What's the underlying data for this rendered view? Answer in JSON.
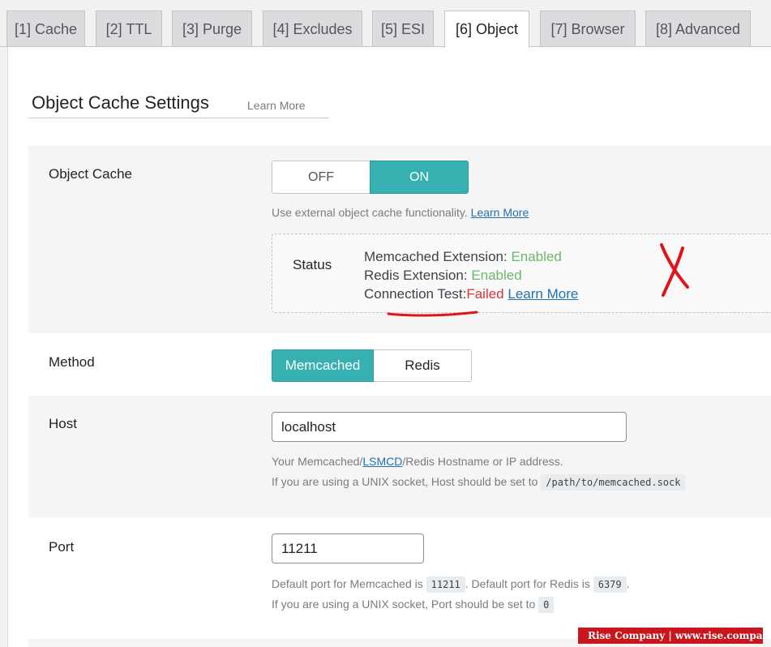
{
  "tabs": [
    {
      "label": "[1] Cache"
    },
    {
      "label": "[2] TTL"
    },
    {
      "label": "[3] Purge"
    },
    {
      "label": "[4] Excludes"
    },
    {
      "label": "[5] ESI"
    },
    {
      "label": "[6] Object"
    },
    {
      "label": "[7] Browser"
    },
    {
      "label": "[8] Advanced"
    }
  ],
  "active_tab": "[6] Object",
  "section": {
    "title": "Object Cache Settings",
    "learn_more": "Learn More"
  },
  "object_cache": {
    "label": "Object Cache",
    "off_label": "OFF",
    "on_label": "ON",
    "selected": "ON",
    "description": "Use external object cache functionality.",
    "description_link": "Learn More"
  },
  "status": {
    "label": "Status",
    "memcached_label": "Memcached Extension:",
    "memcached_value": "Enabled",
    "redis_label": "Redis Extension:",
    "redis_value": "Enabled",
    "connection_label": "Connection Test:",
    "connection_value": "Failed",
    "connection_link": "Learn More"
  },
  "method": {
    "label": "Method",
    "options": [
      "Memcached",
      "Redis"
    ],
    "selected": "Memcached"
  },
  "host": {
    "label": "Host",
    "value": "localhost",
    "desc_prefix": "Your Memcached/",
    "desc_link": "LSMCD",
    "desc_suffix": "/Redis Hostname or IP address.",
    "desc2": "If you are using a UNIX socket, Host should be set to",
    "desc2_code": "/path/to/memcached.sock"
  },
  "port": {
    "label": "Port",
    "value": "11211",
    "desc_a": "Default port for Memcached is",
    "desc_code_a": "11211",
    "desc_b": ". Default port for Redis is",
    "desc_code_b": "6379",
    "desc_c": ".",
    "desc2": "If you are using a UNIX socket, Port should be set to",
    "desc2_code": "0"
  },
  "watermark": {
    "text": "Rise Company | www.rise.company"
  },
  "colors": {
    "accent": "#36b0b0",
    "enabled": "#6fb46f",
    "failed": "#d63638",
    "annotation": "#e0141b",
    "link": "#2271b1"
  }
}
